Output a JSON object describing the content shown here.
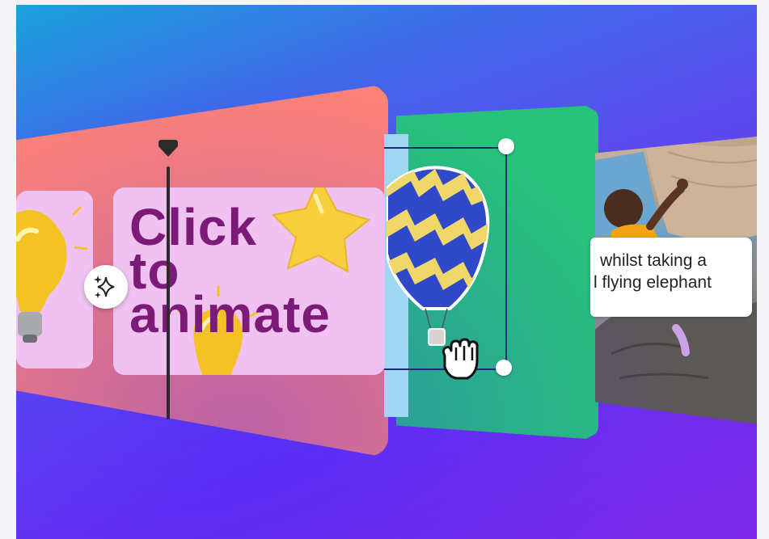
{
  "preview": {
    "headline_lines": [
      "Click",
      "to",
      "animate"
    ],
    "caption_lines": [
      "whilst taking a",
      "l flying elephant"
    ]
  },
  "icons": {
    "playhead_marker": "playhead-marker-icon",
    "magic_animate": "sparkles-icon",
    "grab_cursor": "hand-grab-cursor-icon"
  },
  "colors": {
    "salmon_panel": "#ff8277",
    "pink_card": "#f0c2f1",
    "headline_text": "#7c1a77",
    "green_panel": "#27c37a",
    "selection_border": "#1f2a7a",
    "background_gradient_start": "#1aa3dd",
    "background_gradient_end": "#7c28e6"
  }
}
